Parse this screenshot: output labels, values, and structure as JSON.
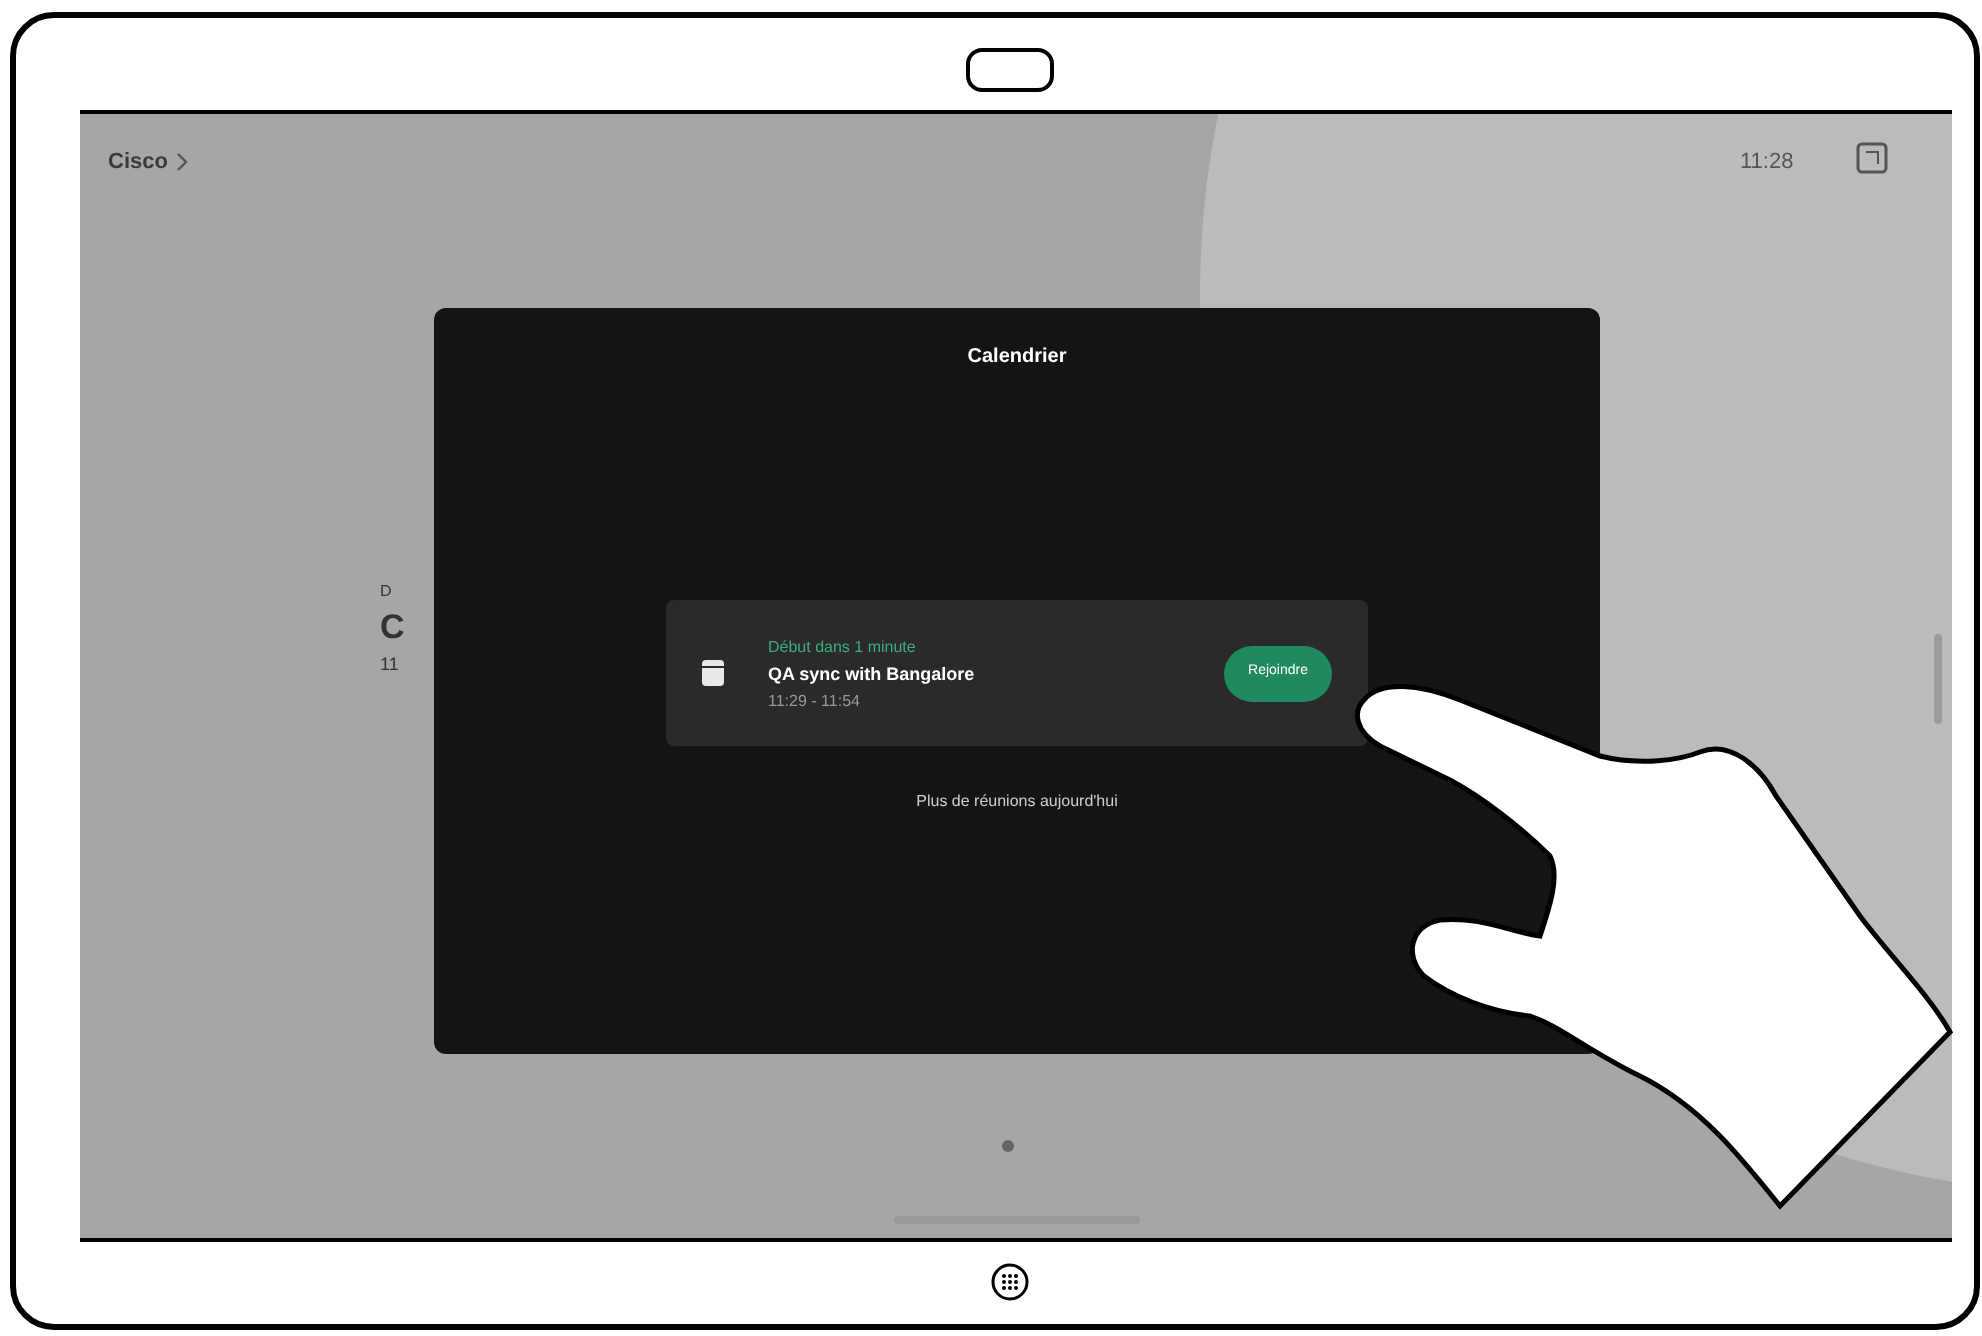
{
  "top_bar": {
    "breadcrumb": "Cisco",
    "time": "11:28"
  },
  "background_texts": [
    "D",
    "C",
    "11"
  ],
  "calendar": {
    "title": "Calendrier",
    "meetings": [
      {
        "status": "Début dans 1 minute",
        "title": "QA sync with Bangalore",
        "time": "11:29 - 11:54",
        "button": "Rejoindre"
      }
    ],
    "footer": "Plus de réunions aujourd'hui"
  }
}
